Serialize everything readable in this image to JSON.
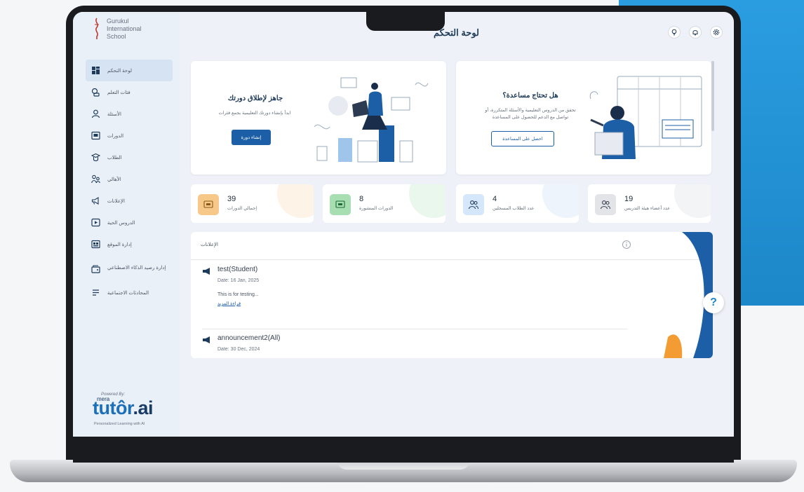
{
  "app": {
    "school_name_line1": "Gurukul",
    "school_name_line2": "International",
    "school_name_line3": "School",
    "page_title": "لوحة التحكم"
  },
  "sidebar": {
    "items": [
      {
        "label": "لوحة التحكم",
        "icon": "dashboard-icon",
        "active": true
      },
      {
        "label": "فئات التعلم",
        "icon": "learning-categories-icon",
        "active": false
      },
      {
        "label": "الأسئلة",
        "icon": "questions-icon",
        "active": false
      },
      {
        "label": "الدورات",
        "icon": "courses-icon",
        "active": false
      },
      {
        "label": "الطلاب",
        "icon": "students-icon",
        "active": false
      },
      {
        "label": "الأهالي",
        "icon": "parents-icon",
        "active": false
      },
      {
        "label": "الإعلانات",
        "icon": "announcements-icon",
        "active": false
      },
      {
        "label": "الدروس الحية",
        "icon": "live-lessons-icon",
        "active": false
      },
      {
        "label": "إدارة الموقع",
        "icon": "site-management-icon",
        "active": false
      },
      {
        "label": "إدارة رصيد الذكاء الاصطناعي",
        "icon": "ai-credits-icon",
        "active": false
      },
      {
        "label": "المحادثات الاجتماعية",
        "icon": "social-chats-icon",
        "active": false
      }
    ],
    "powered_by": "Powered By:",
    "brand_small": "mera",
    "brand_main": "tutôr",
    "brand_ai": ".ai",
    "tagline": "Personalized Learning with AI"
  },
  "cards": {
    "launch": {
      "title": "جاهز لإطلاق دورتك",
      "desc": "ابدأ بإنشاء دورتك التعليمية بجمع فئرات",
      "button": "إنشاء دورة"
    },
    "help": {
      "title": "هل تحتاج مساعدة؟",
      "desc_line1": "تحقق من الدروس التعليمية والأسئلة المتكررة، أو",
      "desc_line2": "تواصل مع الدعم للحصول على المساعدة",
      "button": "احصل على المساعدة"
    }
  },
  "stats": [
    {
      "value": "39",
      "label": "إجمالي الدورات",
      "color": "#f6c98a",
      "circle": "#fdf3e6"
    },
    {
      "value": "8",
      "label": "الدورات المنشورة",
      "color": "#a7dfb3",
      "circle": "#eaf7ec"
    },
    {
      "value": "4",
      "label": "عدد الطلاب المسجلين",
      "color": "#d5e7fb",
      "circle": "#eef4fc"
    },
    {
      "value": "19",
      "label": "عدد أعضاء هيئة التدريس",
      "color": "#e2e4e8",
      "circle": "#f3f4f6"
    }
  ],
  "announcements": {
    "header": "الإعلانات",
    "items": [
      {
        "title": "test(Student)",
        "date": "Date: 16 Jan, 2025",
        "body": "This is for testing...",
        "link": "قراءة المزيد"
      },
      {
        "title": "announcement2(All)",
        "date": "Date: 30 Dec, 2024"
      }
    ]
  },
  "colors": {
    "accent": "#1d5fa6",
    "bg_blue": "#2a9de0"
  }
}
